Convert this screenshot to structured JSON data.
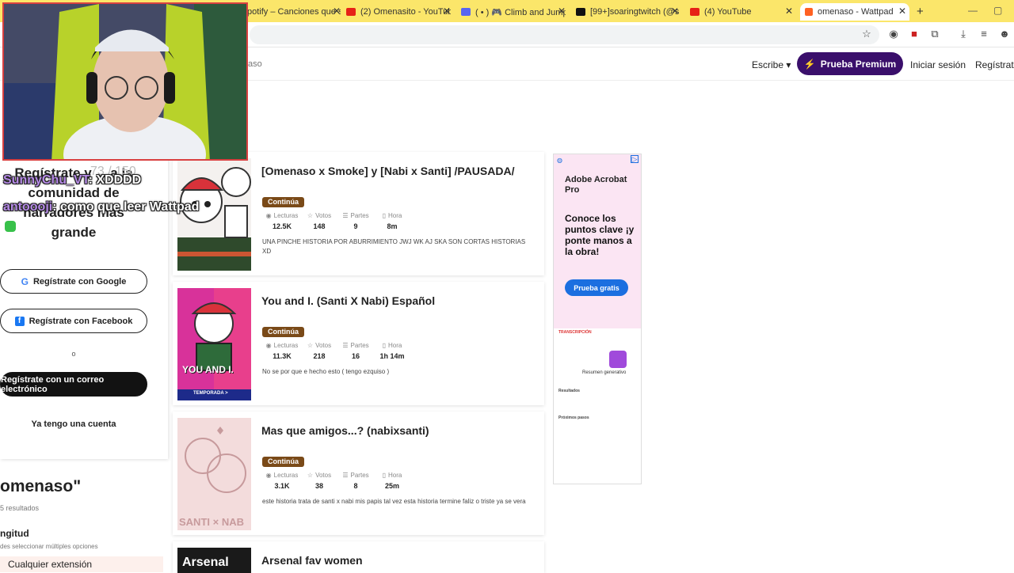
{
  "browser": {
    "tabs": [
      {
        "title": "potify – Canciones que s",
        "active": false
      },
      {
        "title": "(2) Omenasito - YouTube",
        "active": false
      },
      {
        "title": "( • ) 🎮 Climb and Jump T",
        "active": false
      },
      {
        "title": "[99+]soaringtwitch (@s",
        "active": false
      },
      {
        "title": "(4) YouTube",
        "active": false
      },
      {
        "title": "omenaso - Wattpad",
        "active": true
      }
    ]
  },
  "header": {
    "breadcrumb": "aso",
    "write_label": "Escribe",
    "premium_label": "Prueba Premium",
    "login_label": "Iniciar sesión",
    "register_label": "Regístrate"
  },
  "sidebar": {
    "title": "Regístrate y ... a la comunidad de narradores más grande",
    "google_label": "Regístrate con Google",
    "facebook_label": "Regístrate con Facebook",
    "or_label": "o",
    "email_label": "Regístrate con un correo electrónico",
    "have_account_label": "Ya tengo una cuenta"
  },
  "search": {
    "heading": "omenaso\"",
    "results": "5 resultados",
    "filter_title": "ngitud",
    "filter_sub": "des seleccionar múltiples opciones",
    "filter_option": "Cualquier extensión"
  },
  "stat_labels": {
    "reads": "Lecturas",
    "votes": "Votos",
    "parts": "Partes",
    "time": "Hora"
  },
  "stories": [
    {
      "title": "[Omenaso x Smoke] y [Nabi x Santi] /PAUSADA/",
      "badge": "Continúa",
      "reads": "12.5K",
      "votes": "148",
      "parts": "9",
      "time": "8m",
      "description": "UNA PINCHE HISTORIA POR ABURRIMIENTO JWJ WK AJ SKA SON CORTAS HISTORIAS XD"
    },
    {
      "title": "You and I. (Santi X Nabi) Español",
      "badge": "Continúa",
      "reads": "11.3K",
      "votes": "218",
      "parts": "16",
      "time": "1h 14m",
      "description": "No se por que e hecho esto ( tengo ezquiso )",
      "cover_text": "YOU AND I.",
      "cover_sub": "TEMPORADA >"
    },
    {
      "title": "Mas que amigos...? (nabixsanti)",
      "badge": "Continúa",
      "reads": "3.1K",
      "votes": "38",
      "parts": "8",
      "time": "25m",
      "description": "este historia trata de santi x nabi mis papis tal vez esta historia termine faliz o triste ya se vera",
      "cover_text": "SANTI × NAB"
    },
    {
      "title": "Arsenal fav women",
      "cover_text": "Arsenal"
    }
  ],
  "ad": {
    "brand": "Adobe Acrobat Pro",
    "copy": "Conoce los puntos clave ¡y ponte manos a la obra!",
    "cta": "Prueba gratis",
    "section_label": "TRANSCRIPCIÓN",
    "summary_label": "Resumen generativo",
    "results_label": "Resultados",
    "next_label": "Próximos pasos"
  },
  "stream_overlay": {
    "watermark": "73 / 150",
    "chat": [
      {
        "user": "SunnyChu_VT",
        "message": ": XDDDD"
      },
      {
        "user": "antoooji",
        "message": ": como que leer Wattpad"
      }
    ]
  },
  "colors": {
    "tab_bar": "#fbe66a",
    "premium": "#3a0f6b",
    "badge": "#7a4a18",
    "ad_cta": "#1b6fe0"
  }
}
